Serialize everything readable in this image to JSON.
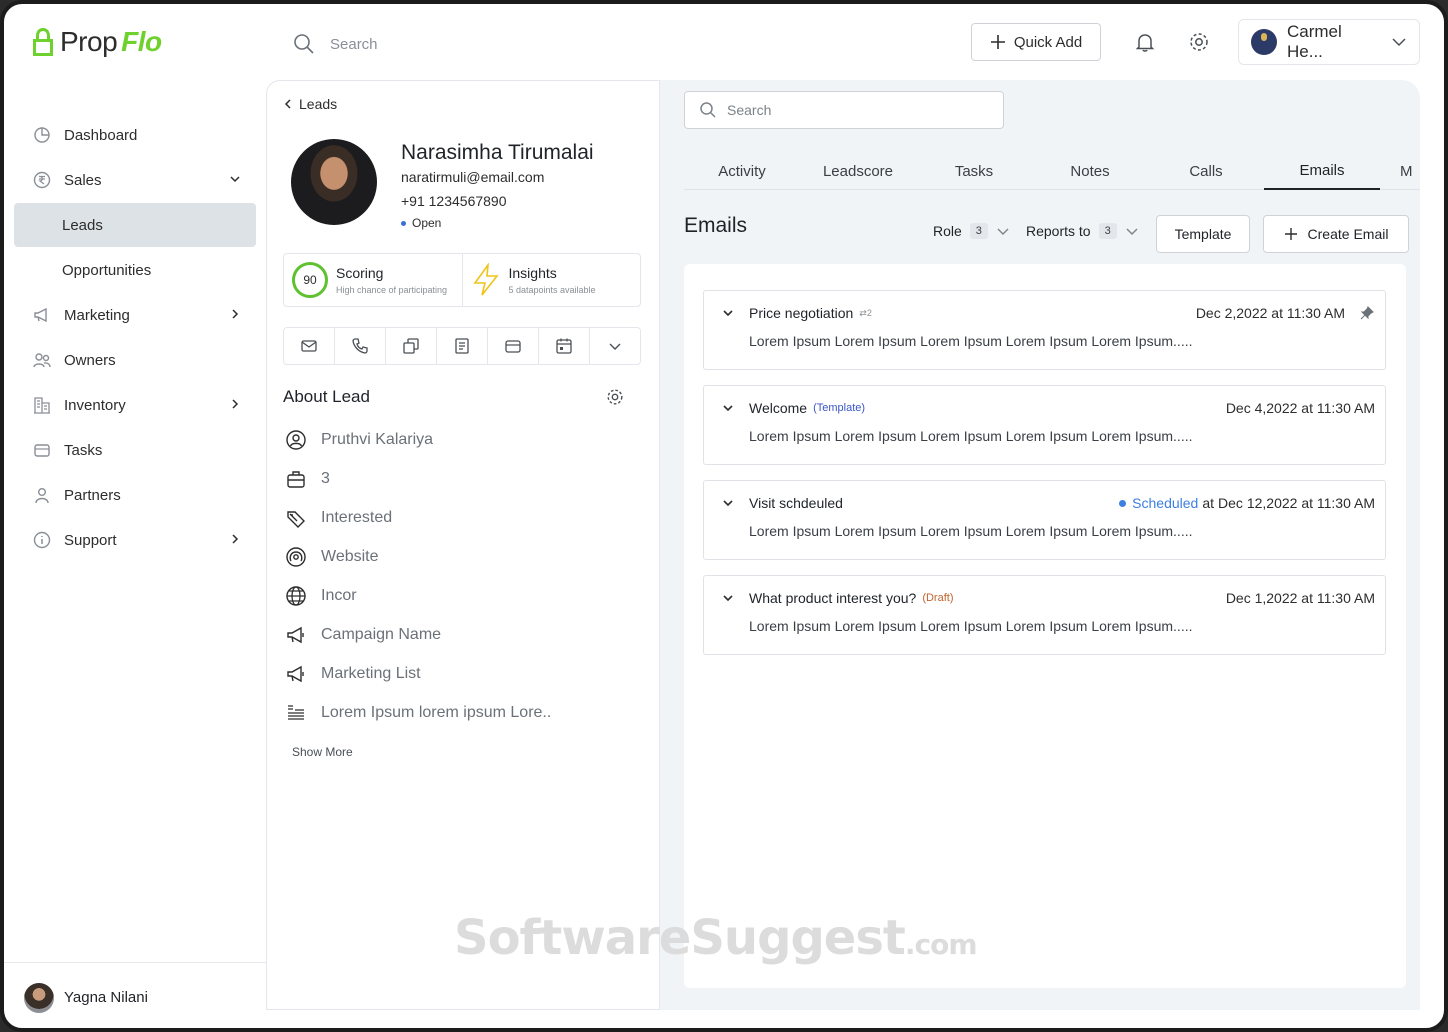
{
  "brand": {
    "name_part1": "Prop",
    "name_part2": "Flo",
    "accent_color": "#6fd12e"
  },
  "topbar": {
    "search_placeholder": "Search",
    "quick_add_label": "Quick Add",
    "user_name": "Carmel He...",
    "icons": [
      "search-icon",
      "plus-icon",
      "bell-icon",
      "gear-icon",
      "chevron-down-icon"
    ]
  },
  "sidebar": {
    "items": [
      {
        "label": "Dashboard",
        "icon": "pie-chart-icon"
      },
      {
        "label": "Sales",
        "icon": "rupee-icon"
      },
      {
        "label": "Leads"
      },
      {
        "label": "Opportunities"
      },
      {
        "label": "Marketing",
        "icon": "megaphone-icon"
      },
      {
        "label": "Owners",
        "icon": "users-icon"
      },
      {
        "label": "Inventory",
        "icon": "building-icon"
      },
      {
        "label": "Tasks",
        "icon": "folder-icon"
      },
      {
        "label": "Partners",
        "icon": "user-icon"
      },
      {
        "label": "Support",
        "icon": "info-icon"
      }
    ],
    "footer_user": "Yagna Nilani"
  },
  "lead": {
    "back_label": "Leads",
    "name": "Narasimha Tirumalai",
    "email": "naratirmuli@email.com",
    "phone": "+91 1234567890",
    "status": "Open",
    "scoring": {
      "value": "90",
      "title": "Scoring",
      "subtitle": "High chance of participating"
    },
    "insights": {
      "title": "Insights",
      "subtitle": "5 datapoints available"
    },
    "actions": [
      "mail-icon",
      "phone-icon",
      "copy-icon",
      "document-icon",
      "folder-icon",
      "calendar-icon",
      "chevron-down-icon"
    ],
    "about_title": "About Lead",
    "about": [
      {
        "icon": "user-circle-icon",
        "value": "Pruthvi Kalariya"
      },
      {
        "icon": "briefcase-icon",
        "value": "3"
      },
      {
        "icon": "tag-icon",
        "value": "Interested"
      },
      {
        "icon": "broadcast-icon",
        "value": "Website"
      },
      {
        "icon": "globe-icon",
        "value": "Incor"
      },
      {
        "icon": "megaphone-icon",
        "value": "Campaign Name"
      },
      {
        "icon": "megaphone-icon",
        "value": "Marketing List"
      },
      {
        "icon": "notes-icon",
        "value": "Lorem Ipsum lorem ipsum Lore.."
      }
    ],
    "show_more": "Show More"
  },
  "main": {
    "search_placeholder": "Search",
    "tabs": [
      "Activity",
      "Leadscore",
      "Tasks",
      "Notes",
      "Calls",
      "Emails",
      "M"
    ],
    "active_tab": "Emails",
    "title": "Emails",
    "filters": [
      {
        "label": "Role",
        "count": "3"
      },
      {
        "label": "Reports to",
        "count": "3"
      }
    ],
    "template_button": "Template",
    "create_button": "Create Email",
    "emails": [
      {
        "subject": "Price negotiation",
        "badge": "2",
        "date": "Dec 2,2022 at 11:30 AM",
        "pinned": true,
        "body": "Lorem Ipsum Lorem Ipsum Lorem Ipsum Lorem Ipsum Lorem Ipsum....."
      },
      {
        "subject": "Welcome",
        "tag": "(Template)",
        "date": "Dec 4,2022 at 11:30 AM",
        "body": "Lorem Ipsum Lorem Ipsum Lorem Ipsum Lorem Ipsum Lorem Ipsum....."
      },
      {
        "subject": "Visit schdeuled",
        "scheduled_label": "Scheduled",
        "at_label": "at",
        "date": "Dec 12,2022 at 11:30 AM",
        "body": "Lorem Ipsum Lorem Ipsum Lorem Ipsum Lorem Ipsum Lorem Ipsum....."
      },
      {
        "subject": "What product interest you?",
        "tag": "(Draft)",
        "date": "Dec 1,2022 at 11:30 AM",
        "body": "Lorem Ipsum Lorem Ipsum Lorem Ipsum Lorem Ipsum Lorem Ipsum....."
      }
    ]
  },
  "watermark": {
    "main": "SoftwareSuggest",
    "suffix": ".com"
  }
}
